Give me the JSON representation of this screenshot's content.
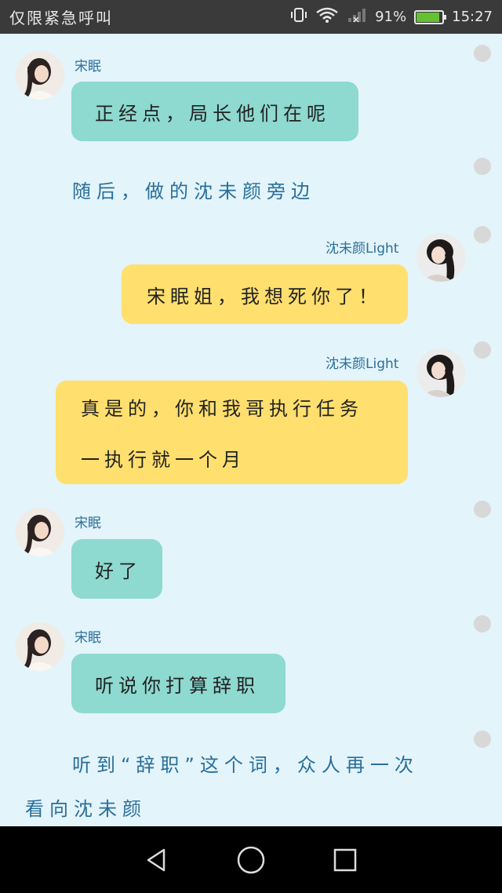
{
  "status_bar": {
    "carrier": "仅限紧急呼叫",
    "battery": "91%",
    "time": "15:27"
  },
  "messages": [
    {
      "sender": "宋眠",
      "text": "正经点，局长他们在呢"
    },
    {
      "narration": "随后，做的沈未颜旁边"
    },
    {
      "sender": "沈未颜Light",
      "text": "宋眠姐，我想死你了！"
    },
    {
      "sender": "沈未颜Light",
      "lines": [
        "真是的，你和我哥执行任务",
        "一执行就一个月"
      ]
    },
    {
      "sender": "宋眠",
      "text": "好了"
    },
    {
      "sender": "宋眠",
      "text": "听说你打算辞职"
    },
    {
      "narration_lines": [
        "听到“辞职”这个词，众人再一次",
        "看向沈未颜"
      ]
    }
  ],
  "icons": {
    "back": "back-triangle-icon",
    "home": "home-circle-icon",
    "recents": "recents-square-icon"
  }
}
